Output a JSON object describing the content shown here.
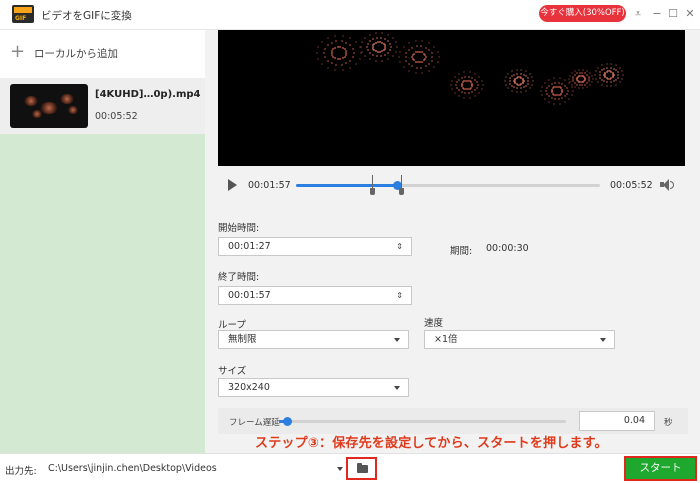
{
  "window": {
    "title": "ビデオをGIFに変換",
    "logo_text": "GIF",
    "promo_label": "今すぐ購入(30%OFF)",
    "controls": {
      "menu": "⩡",
      "minimize": "−",
      "maximize": "☐",
      "close": "✕"
    }
  },
  "sidebar": {
    "add_label": "ローカルから追加",
    "add_icon": "plus-icon",
    "files": [
      {
        "name": "[4KUHD]…0p).mp4",
        "duration": "00:05:52"
      }
    ]
  },
  "player": {
    "current_time": "00:01:57",
    "total_time": "00:05:52",
    "progress": 0.333
  },
  "settings": {
    "start_label": "開始時間:",
    "start_value": "00:01:27",
    "end_label": "終了時間:",
    "end_value": "00:01:57",
    "duration_label": "期間:",
    "duration_value": "00:00:30",
    "loop_label": "ループ",
    "loop_value": "無制限",
    "speed_label": "速度",
    "speed_value": "×1倍",
    "size_label": "サイズ",
    "size_value": "320x240",
    "frame_delay_label": "フレーム遅延",
    "frame_delay_value": "0.04",
    "frame_delay_unit": "秒",
    "frame_delay_slider": 0.02
  },
  "annotation": {
    "text": "ステップ③：保存先を設定してから、スタートを押します。",
    "color": "#e03a1c"
  },
  "output": {
    "label": "出力先:",
    "path": "C:\\Users\\jinjin.chen\\Desktop\\Videos",
    "start_label": "スタート"
  },
  "colors": {
    "accent": "#2a7fe0",
    "start_button": "#1fa82e",
    "highlight_box": "#e0281e",
    "sidebar_bg": "#d4e9d1"
  }
}
